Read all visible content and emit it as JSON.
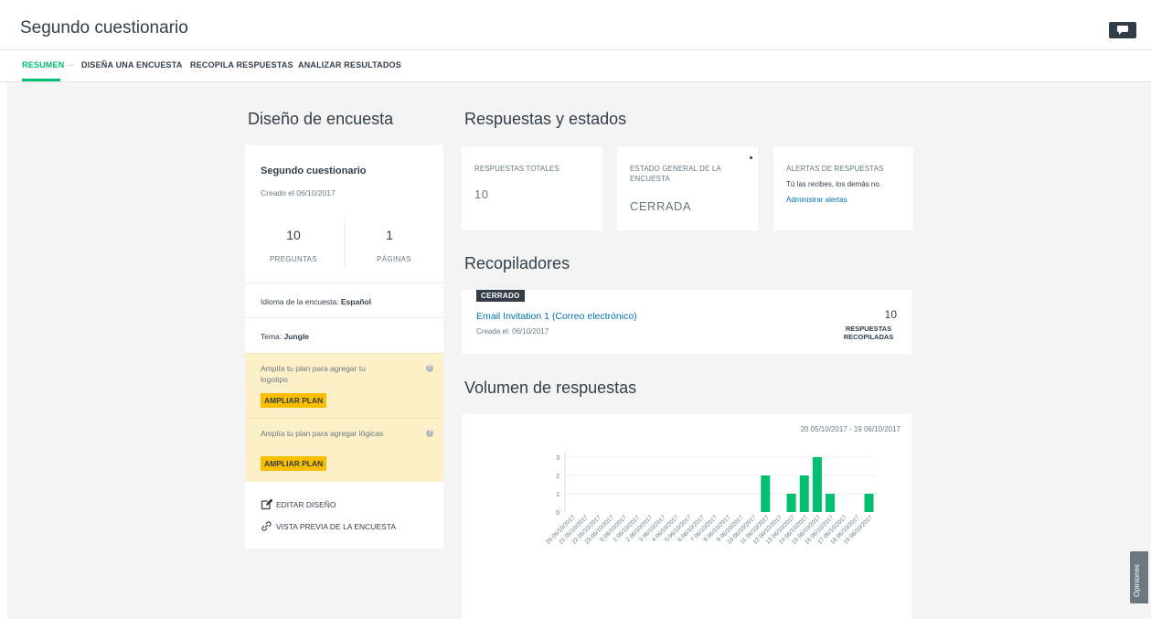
{
  "app": {
    "title": "Segundo cuestionario"
  },
  "nav": {
    "tabs": [
      {
        "label": "RESUMEN"
      },
      {
        "label": "DISEÑA UNA ENCUESTA"
      },
      {
        "label": "RECOPILA RESPUESTAS"
      },
      {
        "label": "ANALIZAR RESULTADOS"
      }
    ],
    "arrow": "→"
  },
  "design": {
    "title": "Diseño de encuesta",
    "survey_name": "Segundo cuestionario",
    "created": "Creado el 06/10/2017",
    "questions_count": "10",
    "questions_label": "PREGUNTAS",
    "pages_count": "1",
    "pages_label": "PÁGINAS",
    "language_label": "Idioma de la encuesta: ",
    "language_value": "Español",
    "theme_label": "Tema: ",
    "theme_value": "Jungle",
    "upsell_logo": "Amplía tu plan para agregar tu logotipo",
    "upsell_logic": "Amplía tu plan para agregar lógicas",
    "upsell_button": "AMPLIAR PLAN",
    "help_glyph": "?",
    "edit_link": "EDITAR DISEÑO",
    "preview_link": "VISTA PREVIA DE LA ENCUESTA"
  },
  "responses": {
    "title": "Respuestas y estados",
    "total_label": "RESPUESTAS TOTALES",
    "total_value": "10",
    "status_label": "ESTADO GENERAL DE LA ENCUESTA",
    "status_value": "CERRADA",
    "alerts_label": "ALERTAS DE RESPUESTAS",
    "alerts_text": "Tú las recibes, los demás no.",
    "alerts_link": "Administrar alertas"
  },
  "collectors": {
    "title": "Recopiladores",
    "badge": "CERRADO",
    "name": "Email Invitation 1 (Correo electrónico)",
    "created": "Creada el: 06/10/2017",
    "count": "10",
    "count_label": "RESPUESTAS RECOPILADAS"
  },
  "volume": {
    "title": "Volumen de respuestas",
    "date_range": "20 05/10/2017 - 19 06/10/2017"
  },
  "feedback_tab": "Opiniones",
  "colors": {
    "accent": "#00bf6f",
    "dark": "#333e48",
    "upsell": "#fcf0c9",
    "button": "#f9be00",
    "link": "#0072b2"
  },
  "icons": {
    "feedback": "speech-bubble-icon",
    "edit": "edit-icon",
    "preview": "link-icon"
  },
  "chart_data": {
    "type": "bar",
    "categories": [
      "20 05/10/2017",
      "21 05/10/2017",
      "22 05/10/2017",
      "23 05/10/2017",
      "0 06/10/2017",
      "1 06/10/2017",
      "2 06/10/2017",
      "3 06/10/2017",
      "4 06/10/2017",
      "5 06/10/2017",
      "6 06/10/2017",
      "7 06/10/2017",
      "8 06/10/2017",
      "9 06/10/2017",
      "10 06/10/2017",
      "11 06/10/2017",
      "12 06/10/2017",
      "13 06/10/2017",
      "14 06/10/2017",
      "15 06/10/2017",
      "16 06/10/2017",
      "17 06/10/2017",
      "18 06/10/2017",
      "19 06/10/2017"
    ],
    "values": [
      0,
      0,
      0,
      0,
      0,
      0,
      0,
      0,
      0,
      0,
      0,
      0,
      0,
      0,
      0,
      2,
      0,
      1,
      2,
      3,
      1,
      0,
      0,
      1
    ],
    "yticks": [
      0,
      1,
      2,
      3
    ],
    "ylim": [
      0,
      3
    ],
    "grid": true,
    "color": "#00bf6f"
  }
}
